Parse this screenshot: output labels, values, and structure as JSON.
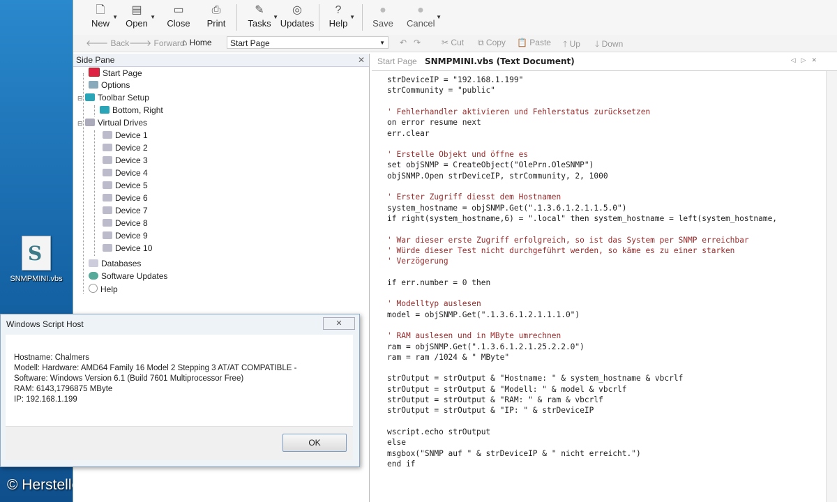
{
  "desktop": {
    "icon_label": "SNMPMINI.vbs",
    "watermark": "© Hersteller/Archiv"
  },
  "toolbar": {
    "buttons": [
      {
        "label": "New",
        "icon": "new-document-icon"
      },
      {
        "label": "Open",
        "icon": "open-icon"
      },
      {
        "label": "Close",
        "icon": "close-window-icon"
      },
      {
        "label": "Print",
        "icon": "printer-icon"
      },
      {
        "label": "Tasks",
        "icon": "tasks-icon"
      },
      {
        "label": "Updates",
        "icon": "updates-icon"
      },
      {
        "label": "Help",
        "icon": "help-icon"
      },
      {
        "label": "Save",
        "icon": "save-icon"
      },
      {
        "label": "Cancel",
        "icon": "cancel-icon"
      }
    ]
  },
  "nav": {
    "back": "Back",
    "forward": "Forward",
    "home": "Home",
    "address": "Start Page",
    "cut": "Cut",
    "copy": "Copy",
    "paste": "Paste",
    "up": "Up",
    "down": "Down"
  },
  "side_pane": {
    "title": "Side Pane",
    "close": "✕",
    "items": [
      {
        "label": "Start Page"
      },
      {
        "label": "Options"
      },
      {
        "label": "Toolbar Setup"
      },
      {
        "label": "Bottom, Right"
      },
      {
        "label": "Virtual Drives"
      },
      {
        "label": "Device 1"
      },
      {
        "label": "Device 2"
      },
      {
        "label": "Device 3"
      },
      {
        "label": "Device 4"
      },
      {
        "label": "Device 5"
      },
      {
        "label": "Device 6"
      },
      {
        "label": "Device 7"
      },
      {
        "label": "Device 8"
      },
      {
        "label": "Device 9"
      },
      {
        "label": "Device 10"
      },
      {
        "label": "Databases"
      },
      {
        "label": "Software Updates"
      },
      {
        "label": "Help"
      }
    ]
  },
  "tabs": {
    "start": "Start Page",
    "active": "SNMPMINI.vbs (Text Document)"
  },
  "code_lines": [
    "strDeviceIP = \"192.168.1.199\"",
    "strCommunity = \"public\"",
    "",
    "' Fehlerhandler aktivieren und Fehlerstatus zurücksetzen",
    "on error resume next",
    "err.clear",
    "",
    "' Erstelle Objekt und öffne es",
    "set objSNMP = CreateObject(\"OlePrn.OleSNMP\")",
    "objSNMP.Open strDeviceIP, strCommunity, 2, 1000",
    "",
    "' Erster Zugriff diesst dem Hostnamen",
    "system_hostname = objSNMP.Get(\".1.3.6.1.2.1.1.5.0\")",
    "if right(system_hostname,6) = \".local\" then system_hostname = left(system_hostname,",
    "",
    "' War dieser erste Zugriff erfolgreich, so ist das System per SNMP erreichbar",
    "' Würde dieser Test nicht durchgeführt werden, so käme es zu einer starken",
    "' Verzögerung",
    "",
    "if err.number = 0 then",
    "",
    "' Modelltyp auslesen",
    "model = objSNMP.Get(\".1.3.6.1.2.1.1.1.0\")",
    "",
    "' RAM auslesen und in MByte umrechnen",
    "ram = objSNMP.Get(\".1.3.6.1.2.1.25.2.2.0\")",
    "ram = ram /1024 & \" MByte\"",
    "",
    "strOutput = strOutput & \"Hostname: \" & system_hostname & vbcrlf",
    "strOutput = strOutput & \"Modell: \" & model & vbcrlf",
    "strOutput = strOutput & \"RAM: \" & ram & vbcrlf",
    "strOutput = strOutput & \"IP: \" & strDeviceIP",
    "",
    "wscript.echo strOutput",
    "else",
    "msgbox(\"SNMP auf \" & strDeviceIP & \" nicht erreicht.\")",
    "end if"
  ],
  "dialog": {
    "title": "Windows Script Host",
    "close": "✕",
    "lines": [
      "Hostname: Chalmers",
      "Modell: Hardware: AMD64 Family 16 Model 2 Stepping 3 AT/AT COMPATIBLE -",
      "Software: Windows Version 6.1 (Build 7601 Multiprocessor Free)",
      "RAM: 6143,1796875 MByte",
      "IP: 192.168.1.199"
    ],
    "ok": "OK"
  }
}
